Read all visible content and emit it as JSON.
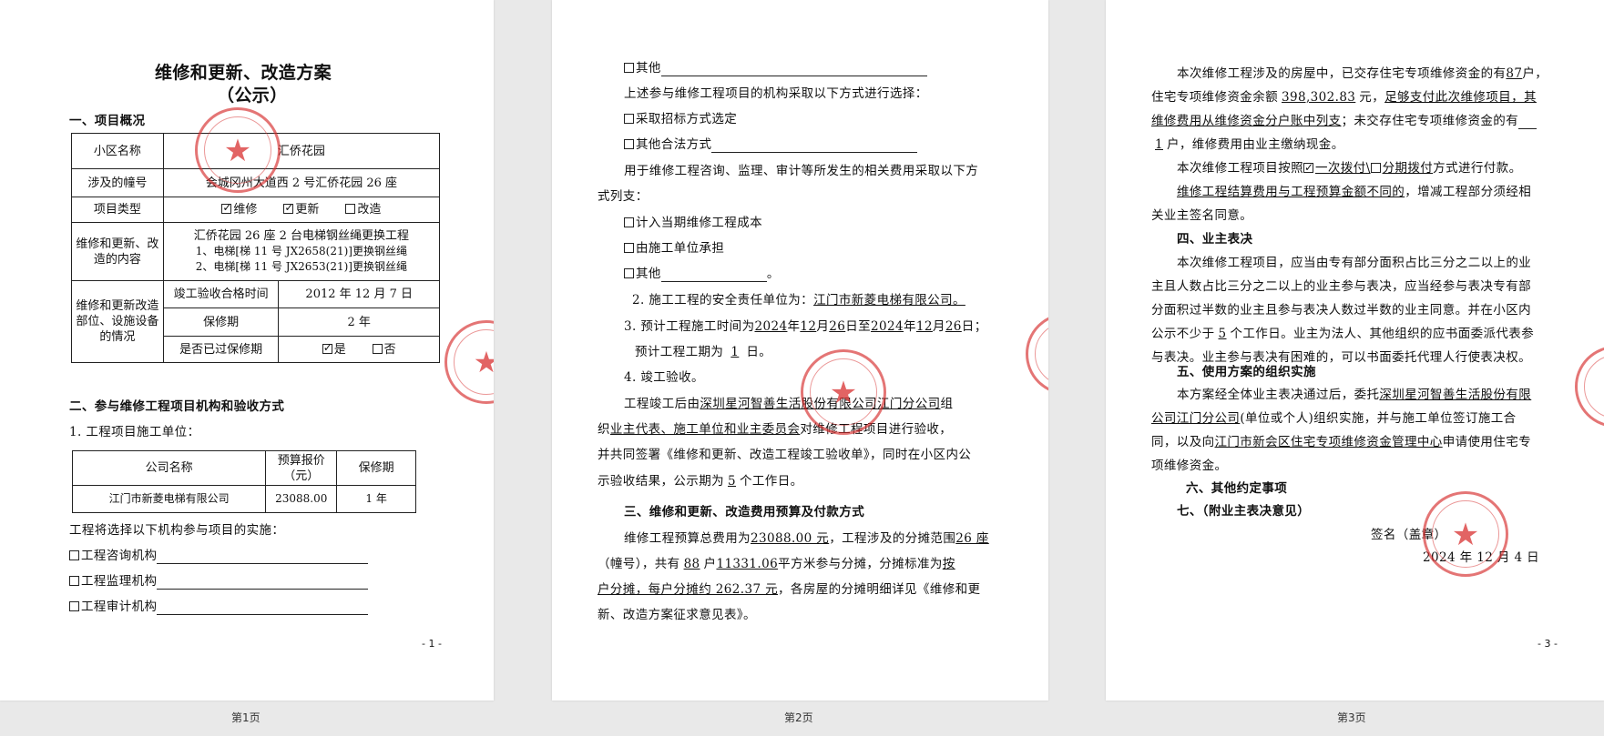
{
  "page_labels": [
    "第1页",
    "第2页",
    "第3页"
  ],
  "page_numbers": [
    "- 1 -",
    "- 2 -",
    "- 3 -"
  ],
  "stamp_color": "#d62828",
  "stamp_text": "深圳星河智善生活股份有限公司江门分公司",
  "page1": {
    "title": "维修和更新、改造方案",
    "subtitle": "（公示）",
    "section1": "一、项目概况",
    "tbl": {
      "r1_label": "小区名称",
      "r1_value": "汇侨花园",
      "r2_label": "涉及的幢号",
      "r2_value": "会城冈州大道西 2 号汇侨花园 26 座",
      "r3_label": "项目类型",
      "type_opts": [
        "维修",
        "更新",
        "改造"
      ],
      "r4_label": "维修和更新、改造的内容",
      "r4_lines": [
        "汇侨花园 26 座 2 台电梯钢丝绳更换工程",
        "1、电梯[梯 11 号 JX2658(21)]更换钢丝绳",
        "2、电梯[梯 11 号 JX2653(21)]更换钢丝绳"
      ],
      "r5_label": "维修和更新改造部位、设施设备的情况",
      "accept_label": "竣工验收合格时间",
      "accept_value": "2012 年 12 月 7 日",
      "warranty_label": "保修期",
      "warranty_value": "2 年",
      "expired_label": "是否已过保修期",
      "yes": "是",
      "no": "否"
    },
    "section2": "二、参与维修工程项目机构和验收方式",
    "unit_line": "1. 工程项目施工单位：",
    "tbl2": {
      "h1": "公司名称",
      "h2": "预算报价（元）",
      "h3": "保修期",
      "c1": "江门市新菱电梯有限公司",
      "c2": "23088.00",
      "c3": "1 年"
    },
    "select_line": "工程将选择以下机构参与项目的实施：",
    "orgs": [
      "工程咨询机构",
      "工程监理机构",
      "工程审计机构"
    ]
  },
  "page2": {
    "other": "其他",
    "line_a": "上述参与维修工程项目的机构采取以下方式进行选择：",
    "opt_a1": "采取招标方式选定",
    "opt_a2": "其他合法方式",
    "line_b1": "用于维修工程咨询、监理、审计等所发生的相关费用采取以下方",
    "line_b2": "式列支：",
    "opt_b1": "计入当期维修工程成本",
    "opt_b2": "由施工单位承担",
    "opt_b3": "其他",
    "period": "。",
    "safety_pre": "2. 施工工程的安全责任单位为：",
    "safety_unit": "江门市新菱电梯有限公司。",
    "plan_pre": "3. 预计工程施工时间为",
    "plan_y1": "2024",
    "plan_t1": "年",
    "plan_m1": "12",
    "plan_t2": "月",
    "plan_d1": "26",
    "plan_t3": "日至",
    "plan_y2": "2024",
    "plan_t4": "年",
    "plan_m2": "12",
    "plan_t5": "月",
    "plan_d2": "26",
    "plan_t6": "日；",
    "dur_pre": "预计工程工期为",
    "dur_val": "1",
    "dur_post": "日。",
    "accept_title": "4. 竣工验收。",
    "acc1_pre": "工程竣工后由",
    "acc1_org": "深圳星河智善生活股份有限公司江门分公司",
    "acc1_post": "组",
    "acc2_pre": "织",
    "acc2_org": "业主代表、施工单位和业主委员会",
    "acc2_post": "对维修工程项目进行验收，",
    "acc3": "并共同签署《维修和更新、改造工程竣工验收单》，同时在小区内公",
    "acc4_pre": "示验收结果，公示期为",
    "acc4_val": "5",
    "acc4_post": "个工作日。",
    "section3": "三、维修和更新、改造费用预算及付款方式",
    "fee1_pre": "维修工程预算总费用为",
    "fee1_amt": "23088.00 元",
    "fee1_mid": "，工程涉及的分摊范围",
    "fee1_scope": "26 座",
    "fee2_pre": "（幢号），共有",
    "fee2_hh": "88",
    "fee2_mid": "户",
    "fee2_area": "11331.06",
    "fee2_post": "平方米参与分摊，分摊标准为",
    "fee2_std": "按",
    "fee3_std": "户分摊，每户分摊约 262.37 元",
    "fee3_post": "，各房屋的分摊明细详见《维修和更",
    "fee4": "新、改造方案征求意见表》。"
  },
  "page3": {
    "p1a_pre": "本次维修工程涉及的房屋中，已交存住宅专项维修资金的有",
    "p1a_val": "87",
    "p1a_post": "户，",
    "p1b_pre": "住宅专项维修资金余额",
    "p1b_val": "398,302.83",
    "p1b_mid": "元，",
    "p1b_ul": "足够支付此次维修项目，其",
    "p1c_ul": "维修费用从维修资金分户账中列支",
    "p1c_post": "；未交存住宅专项维修资金的有",
    "p1d_val": "1",
    "p1d_post": "户，维修费用由业主缴纳现金。",
    "pay_pre": "本次维修工程项目按照",
    "pay_opt1": "一次拨付\\",
    "pay_opt2": "分期拨付",
    "pay_post": "方式进行付款。",
    "diff_ul": "维修工程结算费用与工程预算金额不同的",
    "diff_post": "，增减工程部分须经相",
    "diff2": "关业主签名同意。",
    "section4": "四、业主表决",
    "vote1": "本次维修工程项目，应当由专有部分面积占比三分之二以上的业",
    "vote2": "主且人数占比三分之二以上的业主参与表决，应当经参与表决专有部",
    "vote3": "分面积过半数的业主且参与表决人数过半数的业主同意。并在小区内",
    "vote4_pre": "公示不少于",
    "vote4_val": "5",
    "vote4_post": "个工作日。业主为法人、其他组织的应书面委派代表参",
    "vote5": "与表决。业主参与表决有困难的，可以书面委托代理人行使表决权。",
    "section5": "五、使用方案的组织实施",
    "imp1_pre": "本方案经全体业主表决通过后，委托",
    "imp1_ul": "深圳星河智善生活股份有限",
    "imp2_ul": "公司江门分公司",
    "imp2_post": "(单位或个人)组织实施，并与施工单位签订施工合",
    "imp3_pre": "同，以及向",
    "imp3_ul": "江门市新会区住宅专项维修资金管理中心",
    "imp3_post": "申请使用住宅专",
    "imp4": "项维修资金。",
    "section6": "六、其他约定事项",
    "section7": "七、（附业主表决意见）",
    "sign": "签名（盖章）",
    "date": "2024 年 12 月 4 日"
  }
}
